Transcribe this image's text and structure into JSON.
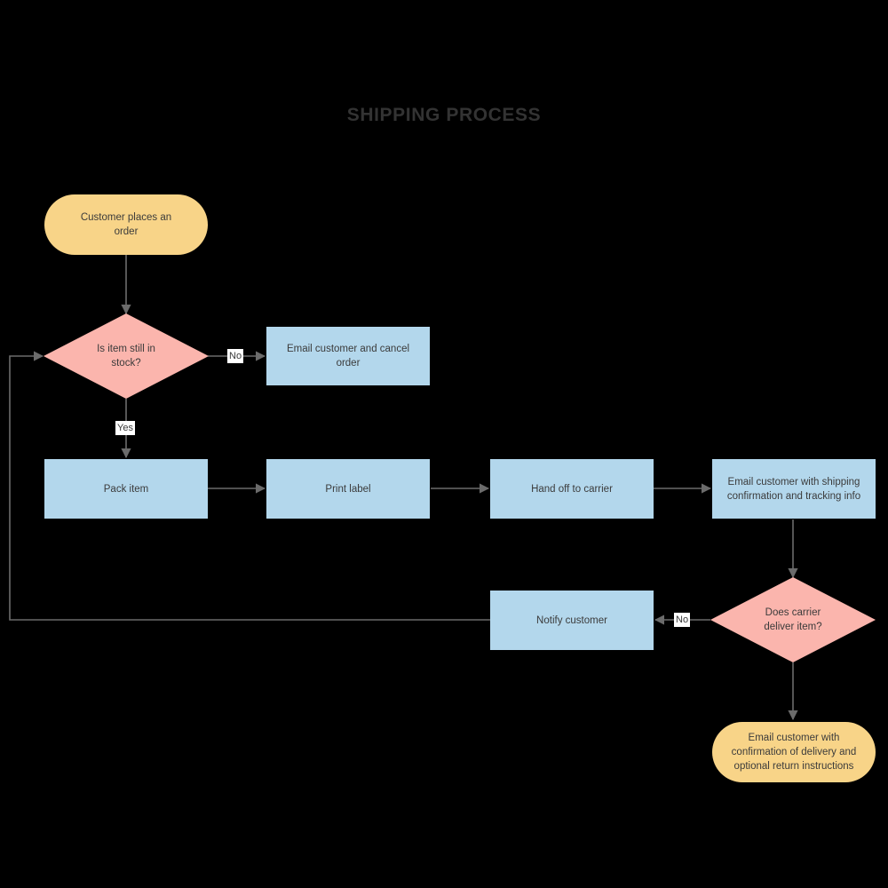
{
  "diagram": {
    "title": "SHIPPING PROCESS",
    "background_color": "#000000",
    "title_color": "#333333",
    "colors": {
      "terminal": "#f8d488",
      "process": "#b3d7ec",
      "decision": "#fbb5ad",
      "connector": "#6b6b6b",
      "node_text": "#3b3b3b",
      "edge_label_background": "#ffffff"
    },
    "nodes": [
      {
        "id": "start",
        "type": "terminal",
        "label": "Customer places an\norder"
      },
      {
        "id": "in-stock",
        "type": "decision",
        "label": "Is item still in\nstock?"
      },
      {
        "id": "cancel-order",
        "type": "process",
        "label": "Email customer and cancel order"
      },
      {
        "id": "pack-item",
        "type": "process",
        "label": "Pack item"
      },
      {
        "id": "print-label",
        "type": "process",
        "label": "Print label"
      },
      {
        "id": "hand-off",
        "type": "process",
        "label": "Hand off to carrier"
      },
      {
        "id": "shipping-confirmation",
        "type": "process",
        "label": "Email customer with shipping\nconfirmation and tracking info"
      },
      {
        "id": "carrier-delivers",
        "type": "decision",
        "label": "Does carrier\ndeliver item?"
      },
      {
        "id": "notify-customer",
        "type": "process",
        "label": "Notify customer"
      },
      {
        "id": "delivery-confirmation",
        "type": "terminal",
        "label": "Email customer with\nconfirmation of delivery and\noptional return instructions"
      }
    ],
    "edge_labels": {
      "stock_no": "No",
      "stock_yes": "Yes",
      "delivery_no": "No"
    }
  }
}
